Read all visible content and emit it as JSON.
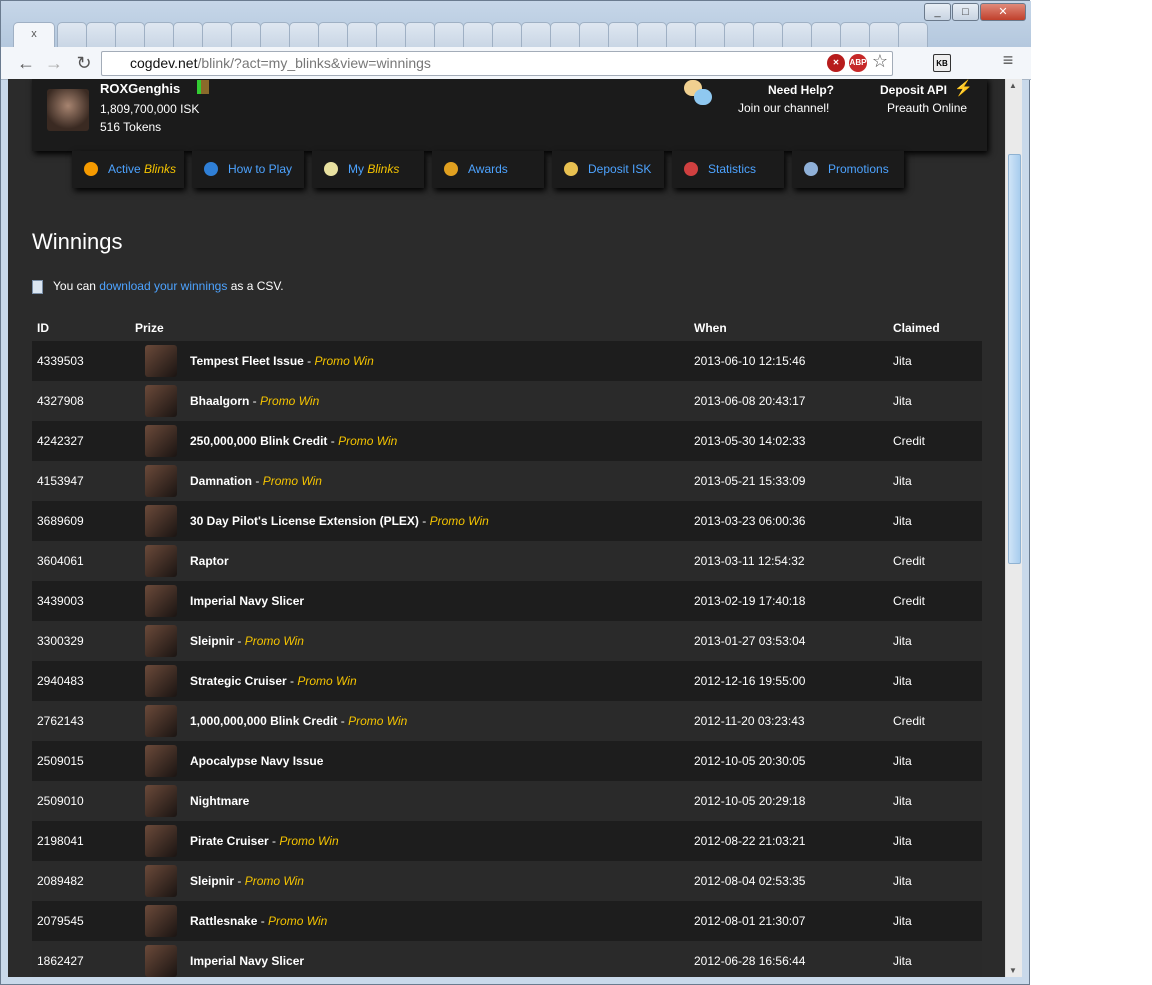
{
  "browser": {
    "url_host": "cogdev.net",
    "url_path": "/blink/?act=my_blinks&view=winnings",
    "active_tab_close": "x"
  },
  "header": {
    "username": "ROXGenghis",
    "isk": "1,809,700,000 ISK",
    "tokens": "516 Tokens",
    "help_title": "Need Help?",
    "help_link": "Join our channel!",
    "api_title": "Deposit API",
    "api_status": "Preauth Online"
  },
  "nav": [
    {
      "label": "Active ",
      "em": "Blinks",
      "icon": "sun-icon",
      "color": "#f59a00"
    },
    {
      "label": "How to Play",
      "em": "",
      "icon": "question-icon",
      "color": "#2f7fd6"
    },
    {
      "label": "My ",
      "em": "Blinks",
      "icon": "bulb-icon",
      "color": "#e8e0a0"
    },
    {
      "label": "Awards",
      "em": "",
      "icon": "medal-icon",
      "color": "#e0a020"
    },
    {
      "label": "Deposit ISK",
      "em": "",
      "icon": "coins-icon",
      "color": "#e8c050"
    },
    {
      "label": "Statistics",
      "em": "",
      "icon": "chart-icon",
      "color": "#d04040"
    },
    {
      "label": "Promotions",
      "em": "",
      "icon": "notebook-icon",
      "color": "#8fb0d8"
    }
  ],
  "page": {
    "title": "Winnings",
    "csv_pre": "You can ",
    "csv_link": "download your winnings",
    "csv_post": " as a CSV."
  },
  "table": {
    "headers": {
      "id": "ID",
      "prize": "Prize",
      "when": "When",
      "claimed": "Claimed"
    },
    "rows": [
      {
        "id": "4339503",
        "prize": "Tempest Fleet Issue",
        "promo": "Promo Win",
        "when": "2013-06-10 12:15:46",
        "claimed": "Jita"
      },
      {
        "id": "4327908",
        "prize": "Bhaalgorn",
        "promo": "Promo Win",
        "when": "2013-06-08 20:43:17",
        "claimed": "Jita"
      },
      {
        "id": "4242327",
        "prize": "250,000,000 Blink Credit",
        "promo": "Promo Win",
        "when": "2013-05-30 14:02:33",
        "claimed": "Credit"
      },
      {
        "id": "4153947",
        "prize": "Damnation",
        "promo": "Promo Win",
        "when": "2013-05-21 15:33:09",
        "claimed": "Jita"
      },
      {
        "id": "3689609",
        "prize": "30 Day Pilot's License Extension (PLEX)",
        "promo": "Promo Win",
        "when": "2013-03-23 06:00:36",
        "claimed": "Jita"
      },
      {
        "id": "3604061",
        "prize": "Raptor",
        "promo": "",
        "when": "2013-03-11 12:54:32",
        "claimed": "Credit"
      },
      {
        "id": "3439003",
        "prize": "Imperial Navy Slicer",
        "promo": "",
        "when": "2013-02-19 17:40:18",
        "claimed": "Credit"
      },
      {
        "id": "3300329",
        "prize": "Sleipnir",
        "promo": "Promo Win",
        "when": "2013-01-27 03:53:04",
        "claimed": "Jita"
      },
      {
        "id": "2940483",
        "prize": "Strategic Cruiser",
        "promo": "Promo Win",
        "when": "2012-12-16 19:55:00",
        "claimed": "Jita"
      },
      {
        "id": "2762143",
        "prize": "1,000,000,000 Blink Credit",
        "promo": "Promo Win",
        "when": "2012-11-20 03:23:43",
        "claimed": "Credit"
      },
      {
        "id": "2509015",
        "prize": "Apocalypse Navy Issue",
        "promo": "",
        "when": "2012-10-05 20:30:05",
        "claimed": "Jita"
      },
      {
        "id": "2509010",
        "prize": "Nightmare",
        "promo": "",
        "when": "2012-10-05 20:29:18",
        "claimed": "Jita"
      },
      {
        "id": "2198041",
        "prize": "Pirate Cruiser",
        "promo": "Promo Win",
        "when": "2012-08-22 21:03:21",
        "claimed": "Jita"
      },
      {
        "id": "2089482",
        "prize": "Sleipnir",
        "promo": "Promo Win",
        "when": "2012-08-04 02:53:35",
        "claimed": "Jita"
      },
      {
        "id": "2079545",
        "prize": "Rattlesnake",
        "promo": "Promo Win",
        "when": "2012-08-01 21:30:07",
        "claimed": "Jita"
      },
      {
        "id": "1862427",
        "prize": "Imperial Navy Slicer",
        "promo": "",
        "when": "2012-06-28 16:56:44",
        "claimed": "Jita"
      }
    ]
  }
}
